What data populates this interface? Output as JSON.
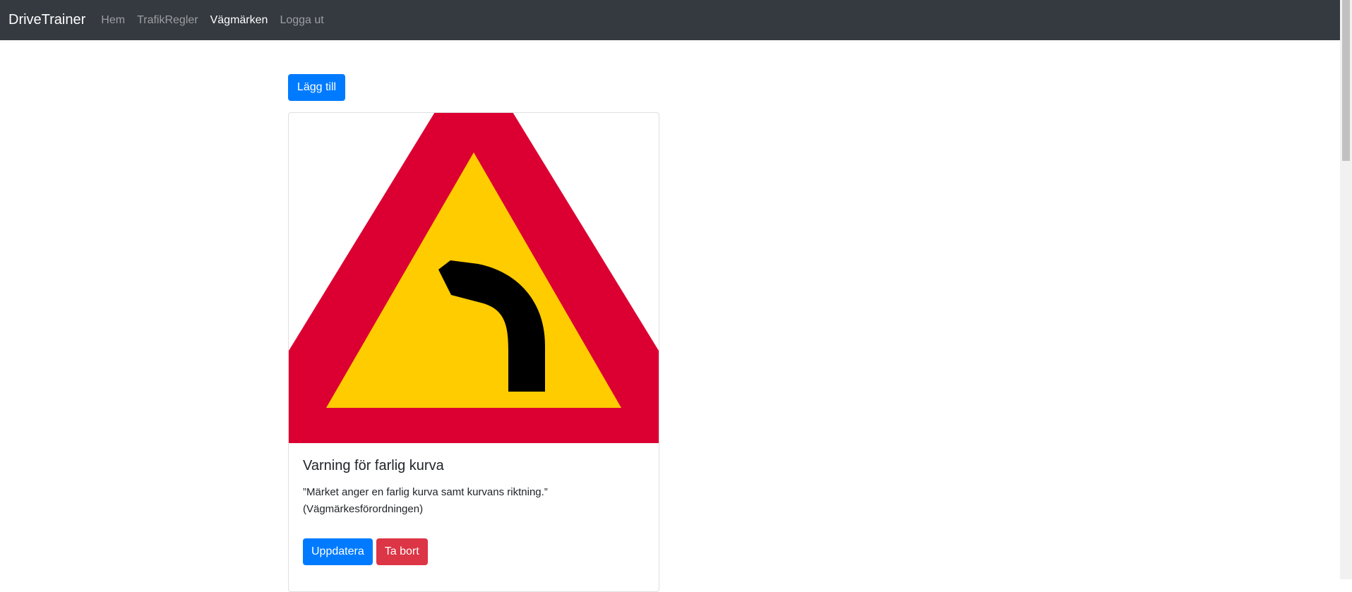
{
  "navbar": {
    "brand": "DriveTrainer",
    "links": [
      {
        "label": "Hem",
        "active": false
      },
      {
        "label": "TrafikRegler",
        "active": false
      },
      {
        "label": "Vägmärken",
        "active": true
      },
      {
        "label": "Logga ut",
        "active": false
      }
    ]
  },
  "toolbar": {
    "add_label": "Lägg till"
  },
  "sign_card": {
    "image_icon": "curve-left-warning-sign-icon",
    "title": "Varning för farlig kurva",
    "description": "”Märket anger en farlig kurva samt kurvans riktning.” (Vägmärkesförordningen)",
    "update_label": "Uppdatera",
    "delete_label": "Ta bort"
  },
  "colors": {
    "navbar_bg": "#343a40",
    "primary": "#007bff",
    "danger": "#dc3545",
    "sign_red": "#dc0032",
    "sign_yellow": "#ffcc00"
  }
}
